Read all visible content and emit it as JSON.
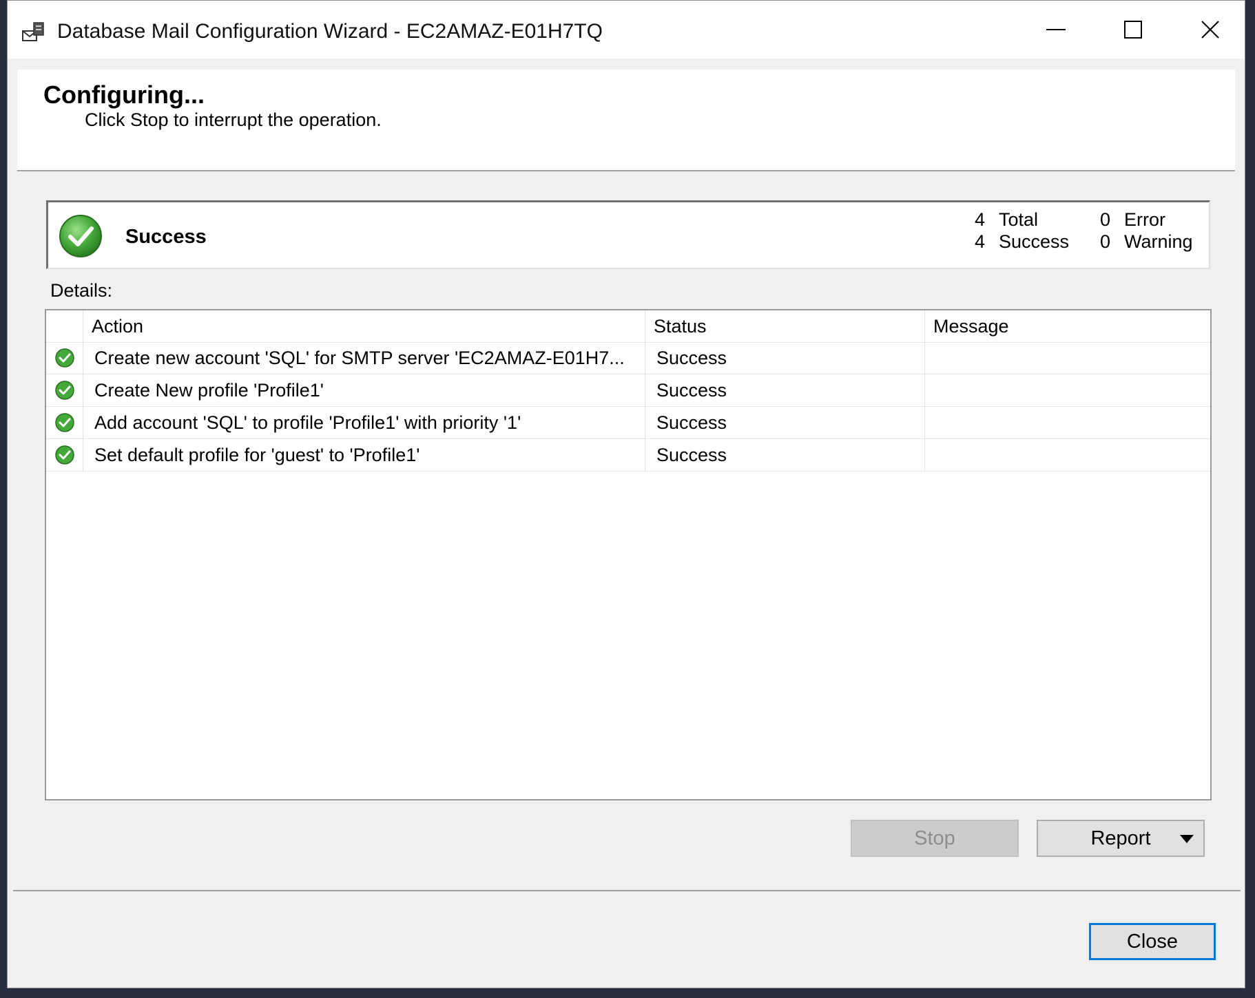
{
  "window": {
    "title": "Database Mail Configuration Wizard - EC2AMAZ-E01H7TQ",
    "icon": "mail-config-icon",
    "controls": {
      "minimize": "minimize-icon",
      "maximize": "maximize-icon",
      "close": "close-icon"
    }
  },
  "header": {
    "title": "Configuring...",
    "subtitle": "Click Stop to interrupt the operation."
  },
  "status": {
    "label": "Success",
    "icon": "success-check-icon",
    "counts": {
      "total": {
        "value": "4",
        "label": "Total"
      },
      "success": {
        "value": "4",
        "label": "Success"
      },
      "error": {
        "value": "0",
        "label": "Error"
      },
      "warning": {
        "value": "0",
        "label": "Warning"
      }
    }
  },
  "details": {
    "label": "Details:",
    "columns": [
      "Action",
      "Status",
      "Message"
    ],
    "rows": [
      {
        "action": "Create new account 'SQL' for SMTP server 'EC2AMAZ-E01H7...",
        "status": "Success",
        "message": ""
      },
      {
        "action": "Create New profile 'Profile1'",
        "status": "Success",
        "message": ""
      },
      {
        "action": "Add account 'SQL' to profile 'Profile1' with priority '1'",
        "status": "Success",
        "message": ""
      },
      {
        "action": "Set default profile for 'guest' to 'Profile1'",
        "status": "Success",
        "message": ""
      }
    ]
  },
  "buttons": {
    "stop": "Stop",
    "report": "Report",
    "close": "Close"
  },
  "colors": {
    "accent": "#0078d7",
    "success_green": "#3fa53f"
  }
}
